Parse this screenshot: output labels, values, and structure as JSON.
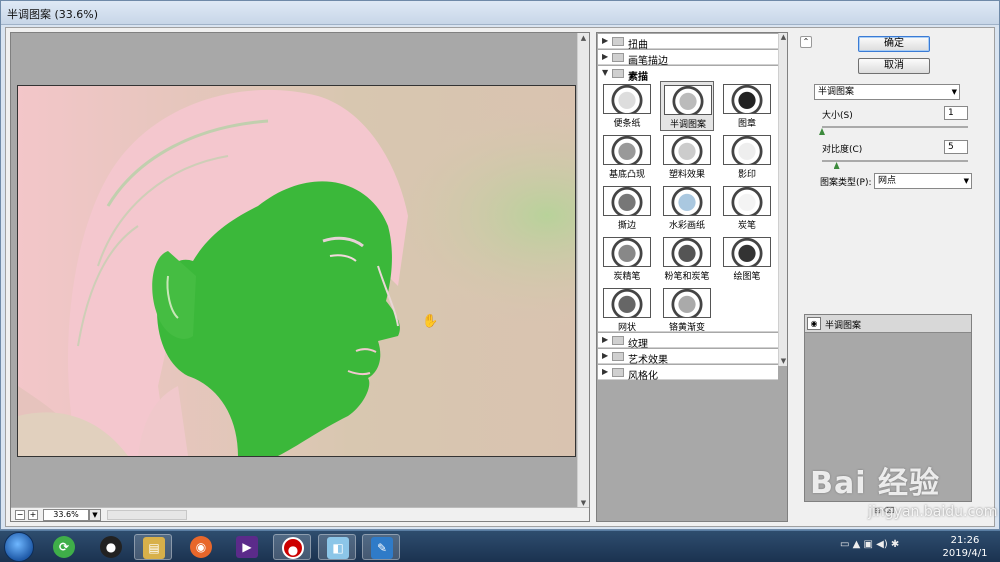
{
  "window": {
    "title": "半调图案 (33.6%)"
  },
  "preview": {
    "zoom": "33.6%"
  },
  "gallery": {
    "categories_top": [
      "扭曲",
      "画笔描边"
    ],
    "open_category": "素描",
    "filters": [
      "便条纸",
      "半调图案",
      "图章",
      "基底凸现",
      "塑料效果",
      "影印",
      "撕边",
      "水彩画纸",
      "炭笔",
      "炭精笔",
      "粉笔和炭笔",
      "绘图笔",
      "网状",
      "铬黄渐变"
    ],
    "selected_filter": "半调图案",
    "categories_bottom": [
      "纹理",
      "艺术效果",
      "风格化"
    ]
  },
  "panel": {
    "ok": "确定",
    "cancel": "取消",
    "filter_select": "半调图案",
    "size_label": "大小(S)",
    "size_value": "1",
    "size_fraction": 0.0,
    "contrast_label": "对比度(C)",
    "contrast_value": "5",
    "contrast_fraction": 0.1,
    "pattern_label": "图案类型(P):",
    "pattern_value": "网点",
    "layer_name": "半调图案"
  },
  "watermark": {
    "brand": "Bai  经验",
    "url": "jingyan.baidu.com"
  },
  "taskbar": {
    "time": "21:26",
    "date": "2019/4/1"
  }
}
